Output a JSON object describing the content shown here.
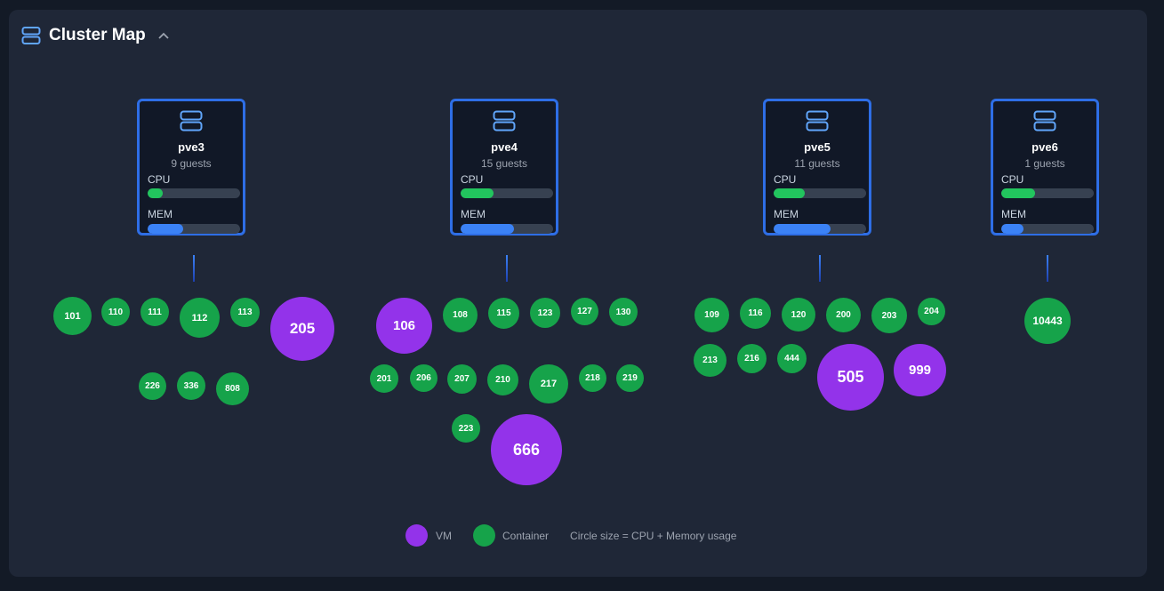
{
  "header": {
    "title": "Cluster Map"
  },
  "colors": {
    "vm": "#9333ea",
    "container": "#16a34a",
    "cpu": "#22c55e",
    "mem": "#3b82f6",
    "node_border": "#2e6ee6"
  },
  "metric_labels": {
    "cpu": "CPU",
    "mem": "MEM"
  },
  "nodes": [
    {
      "name": "pve3",
      "guests_label": "9 guests",
      "cpu": 0.16,
      "mem": 0.38,
      "guests": [
        {
          "id": "101",
          "type": "container"
        },
        {
          "id": "110",
          "type": "container"
        },
        {
          "id": "111",
          "type": "container"
        },
        {
          "id": "112",
          "type": "container"
        },
        {
          "id": "113",
          "type": "container"
        },
        {
          "id": "205",
          "type": "vm"
        },
        {
          "id": "226",
          "type": "container"
        },
        {
          "id": "336",
          "type": "container"
        },
        {
          "id": "808",
          "type": "container"
        }
      ]
    },
    {
      "name": "pve4",
      "guests_label": "15 guests",
      "cpu": 0.36,
      "mem": 0.58,
      "guests": [
        {
          "id": "106",
          "type": "vm"
        },
        {
          "id": "108",
          "type": "container"
        },
        {
          "id": "115",
          "type": "container"
        },
        {
          "id": "123",
          "type": "container"
        },
        {
          "id": "127",
          "type": "container"
        },
        {
          "id": "130",
          "type": "container"
        },
        {
          "id": "201",
          "type": "container"
        },
        {
          "id": "206",
          "type": "container"
        },
        {
          "id": "207",
          "type": "container"
        },
        {
          "id": "210",
          "type": "container"
        },
        {
          "id": "217",
          "type": "container"
        },
        {
          "id": "218",
          "type": "container"
        },
        {
          "id": "219",
          "type": "container"
        },
        {
          "id": "223",
          "type": "container"
        },
        {
          "id": "666",
          "type": "vm"
        }
      ]
    },
    {
      "name": "pve5",
      "guests_label": "11 guests",
      "cpu": 0.34,
      "mem": 0.62,
      "guests": [
        {
          "id": "109",
          "type": "container"
        },
        {
          "id": "116",
          "type": "container"
        },
        {
          "id": "120",
          "type": "container"
        },
        {
          "id": "200",
          "type": "container"
        },
        {
          "id": "203",
          "type": "container"
        },
        {
          "id": "204",
          "type": "container"
        },
        {
          "id": "213",
          "type": "container"
        },
        {
          "id": "216",
          "type": "container"
        },
        {
          "id": "444",
          "type": "container"
        },
        {
          "id": "505",
          "type": "vm"
        },
        {
          "id": "999",
          "type": "vm"
        }
      ]
    },
    {
      "name": "pve6",
      "guests_label": "1 guests",
      "cpu": 0.37,
      "mem": 0.24,
      "guests": [
        {
          "id": "10443",
          "type": "container"
        }
      ]
    }
  ],
  "legend": {
    "vm_label": "VM",
    "container_label": "Container",
    "note": "Circle size = CPU + Memory usage"
  }
}
